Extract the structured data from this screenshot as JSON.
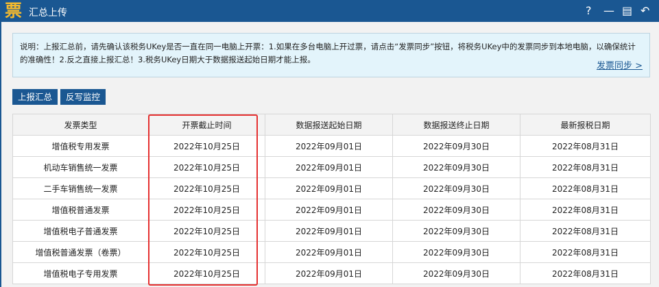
{
  "app": {
    "logo_char": "票",
    "title": "汇总上传",
    "controls": [
      "?",
      "—",
      "▤",
      "↶"
    ]
  },
  "info": {
    "text": "说明：上报汇总前，请先确认该税务UKey是否一直在同一电脑上开票：1.如果在多台电脑上开过票，请点击“发票同步”按钮，将税务UKey中的发票同步到本地电脑，以确保统计的准确性！2.反之直接上报汇总！3.税务UKey日期大于数据报送起始日期才能上报。",
    "sync_link": "发票同步 >"
  },
  "buttons": {
    "upload": "上报汇总",
    "writeback": "反写监控"
  },
  "table": {
    "headers": [
      "发票类型",
      "开票截止时间",
      "数据报送起始日期",
      "数据报送终止日期",
      "最新报税日期"
    ],
    "rows": [
      [
        "增值税专用发票",
        "2022年10月25日",
        "2022年09月01日",
        "2022年09月30日",
        "2022年08月31日"
      ],
      [
        "机动车销售统一发票",
        "2022年10月25日",
        "2022年09月01日",
        "2022年09月30日",
        "2022年08月31日"
      ],
      [
        "二手车销售统一发票",
        "2022年10月25日",
        "2022年09月01日",
        "2022年09月30日",
        "2022年08月31日"
      ],
      [
        "增值税普通发票",
        "2022年10月25日",
        "2022年09月01日",
        "2022年09月30日",
        "2022年08月31日"
      ],
      [
        "增值税电子普通发票",
        "2022年10月25日",
        "2022年09月01日",
        "2022年09月30日",
        "2022年08月31日"
      ],
      [
        "增值税普通发票（卷票）",
        "2022年10月25日",
        "2022年09月01日",
        "2022年09月30日",
        "2022年08月31日"
      ],
      [
        "增值税电子专用发票",
        "2022年10月25日",
        "2022年09月01日",
        "2022年09月30日",
        "2022年08月31日"
      ]
    ]
  }
}
